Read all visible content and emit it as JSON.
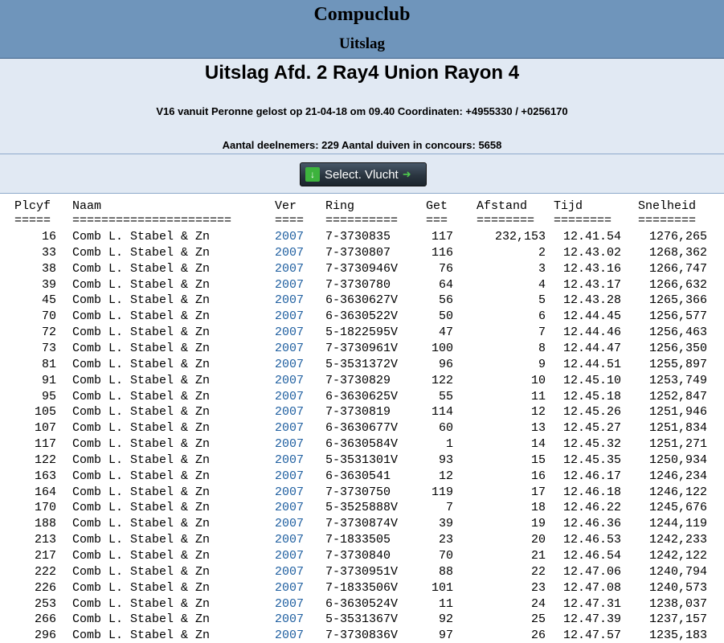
{
  "header": {
    "club": "Compuclub",
    "subtitle": "Uitslag"
  },
  "info": {
    "title": "Uitslag Afd. 2 Ray4 Union Rayon 4",
    "flight": "V16 vanuit Peronne gelost op 21-04-18 om 09.40 Coordinaten: +4955330 / +0256170",
    "counts": "Aantal deelnemers: 229 Aantal duiven in concours: 5658"
  },
  "select_button": {
    "label": "Select. Vlucht"
  },
  "table": {
    "headers": [
      "Plcyf",
      "Naam",
      "Ver",
      "Ring",
      "Get",
      "Afstand",
      "Tijd",
      "Snelheid"
    ],
    "separators": [
      "=====",
      "======================",
      "====",
      "==========",
      "===",
      "========",
      "========",
      "========"
    ],
    "rows": [
      [
        "16",
        "Comb L. Stabel & Zn",
        "2007",
        "7-3730835",
        "117",
        "232,153",
        "12.41.54",
        "1276,265"
      ],
      [
        "33",
        "Comb L. Stabel & Zn",
        "2007",
        "7-3730807",
        "116",
        "2",
        "12.43.02",
        "1268,362"
      ],
      [
        "38",
        "Comb L. Stabel & Zn",
        "2007",
        "7-3730946V",
        "76",
        "3",
        "12.43.16",
        "1266,747"
      ],
      [
        "39",
        "Comb L. Stabel & Zn",
        "2007",
        "7-3730780",
        "64",
        "4",
        "12.43.17",
        "1266,632"
      ],
      [
        "45",
        "Comb L. Stabel & Zn",
        "2007",
        "6-3630627V",
        "56",
        "5",
        "12.43.28",
        "1265,366"
      ],
      [
        "70",
        "Comb L. Stabel & Zn",
        "2007",
        "6-3630522V",
        "50",
        "6",
        "12.44.45",
        "1256,577"
      ],
      [
        "72",
        "Comb L. Stabel & Zn",
        "2007",
        "5-1822595V",
        "47",
        "7",
        "12.44.46",
        "1256,463"
      ],
      [
        "73",
        "Comb L. Stabel & Zn",
        "2007",
        "7-3730961V",
        "100",
        "8",
        "12.44.47",
        "1256,350"
      ],
      [
        "81",
        "Comb L. Stabel & Zn",
        "2007",
        "5-3531372V",
        "96",
        "9",
        "12.44.51",
        "1255,897"
      ],
      [
        "91",
        "Comb L. Stabel & Zn",
        "2007",
        "7-3730829",
        "122",
        "10",
        "12.45.10",
        "1253,749"
      ],
      [
        "95",
        "Comb L. Stabel & Zn",
        "2007",
        "6-3630625V",
        "55",
        "11",
        "12.45.18",
        "1252,847"
      ],
      [
        "105",
        "Comb L. Stabel & Zn",
        "2007",
        "7-3730819",
        "114",
        "12",
        "12.45.26",
        "1251,946"
      ],
      [
        "107",
        "Comb L. Stabel & Zn",
        "2007",
        "6-3630677V",
        "60",
        "13",
        "12.45.27",
        "1251,834"
      ],
      [
        "117",
        "Comb L. Stabel & Zn",
        "2007",
        "6-3630584V",
        "1",
        "14",
        "12.45.32",
        "1251,271"
      ],
      [
        "122",
        "Comb L. Stabel & Zn",
        "2007",
        "5-3531301V",
        "93",
        "15",
        "12.45.35",
        "1250,934"
      ],
      [
        "163",
        "Comb L. Stabel & Zn",
        "2007",
        "6-3630541",
        "12",
        "16",
        "12.46.17",
        "1246,234"
      ],
      [
        "164",
        "Comb L. Stabel & Zn",
        "2007",
        "7-3730750",
        "119",
        "17",
        "12.46.18",
        "1246,122"
      ],
      [
        "170",
        "Comb L. Stabel & Zn",
        "2007",
        "5-3525888V",
        "7",
        "18",
        "12.46.22",
        "1245,676"
      ],
      [
        "188",
        "Comb L. Stabel & Zn",
        "2007",
        "7-3730874V",
        "39",
        "19",
        "12.46.36",
        "1244,119"
      ],
      [
        "213",
        "Comb L. Stabel & Zn",
        "2007",
        "7-1833505",
        "23",
        "20",
        "12.46.53",
        "1242,233"
      ],
      [
        "217",
        "Comb L. Stabel & Zn",
        "2007",
        "7-3730840",
        "70",
        "21",
        "12.46.54",
        "1242,122"
      ],
      [
        "222",
        "Comb L. Stabel & Zn",
        "2007",
        "7-3730951V",
        "88",
        "22",
        "12.47.06",
        "1240,794"
      ],
      [
        "226",
        "Comb L. Stabel & Zn",
        "2007",
        "7-1833506V",
        "101",
        "23",
        "12.47.08",
        "1240,573"
      ],
      [
        "253",
        "Comb L. Stabel & Zn",
        "2007",
        "6-3630524V",
        "11",
        "24",
        "12.47.31",
        "1238,037"
      ],
      [
        "266",
        "Comb L. Stabel & Zn",
        "2007",
        "5-3531367V",
        "92",
        "25",
        "12.47.39",
        "1237,157"
      ],
      [
        "296",
        "Comb L. Stabel & Zn",
        "2007",
        "7-3730836V",
        "97",
        "26",
        "12.47.57",
        "1235,183"
      ]
    ]
  },
  "colors": {
    "header_bg": "#6f95bb",
    "panel_bg": "#e1e9f3",
    "link": "#1f5fa0"
  }
}
